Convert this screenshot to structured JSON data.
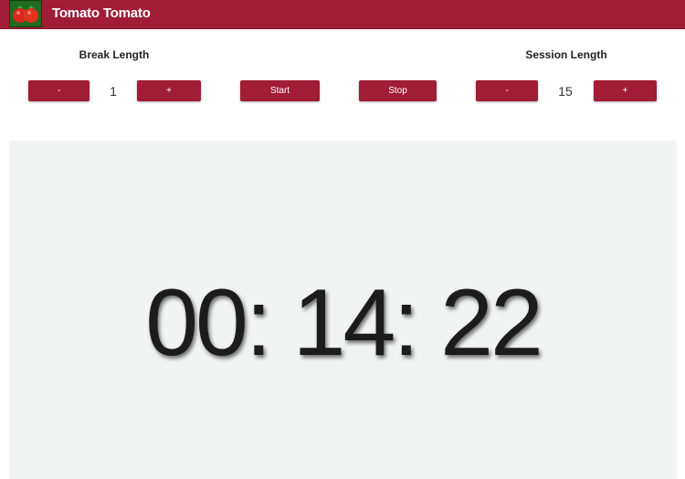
{
  "header": {
    "brand": "Tomato Tomato",
    "logo_icon": "tomato-logo-icon",
    "color": "#a11d37"
  },
  "break_length": {
    "label": "Break Length",
    "value": "1",
    "decrement_label": "-",
    "increment_label": "+"
  },
  "controls": {
    "start_label": "Start",
    "stop_label": "Stop"
  },
  "session_length": {
    "label": "Session Length",
    "value": "15",
    "decrement_label": "-",
    "increment_label": "+"
  },
  "timer": {
    "display": "00: 14: 22"
  },
  "colors": {
    "accent": "#a11d37",
    "panel_background": "#f2f4f3"
  }
}
